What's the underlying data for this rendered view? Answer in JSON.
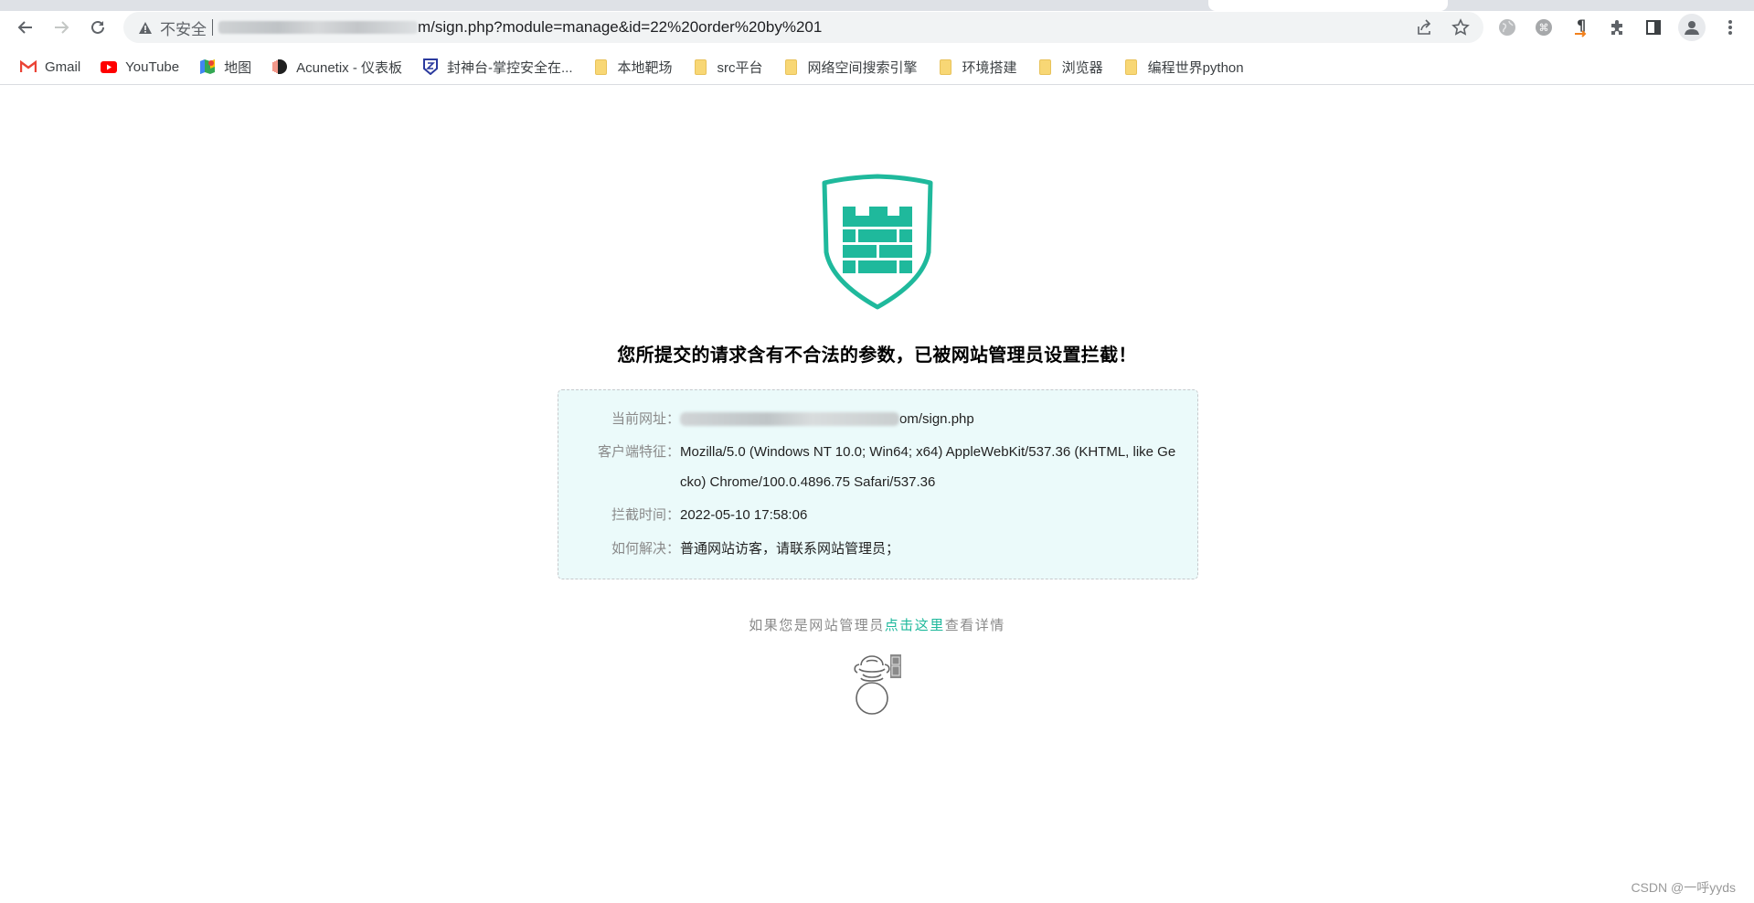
{
  "browser": {
    "nav": {
      "back_icon": "arrow-left-icon",
      "forward_icon": "arrow-right-icon",
      "reload_icon": "reload-icon"
    },
    "omnibox": {
      "security_label": "不安全",
      "url_visible": "m/sign.php?module=manage&id=22%20order%20by%201",
      "icons": [
        "share-icon",
        "bookmark-star-icon"
      ]
    },
    "extensions": [
      "globe-extension-icon",
      "command-extension-icon",
      "paragraph-extension-icon",
      "puzzle-extensions-icon",
      "side-panel-icon",
      "profile-avatar-icon",
      "more-menu-icon"
    ],
    "bookmarks": [
      {
        "label": "Gmail",
        "icon": "gmail-icon"
      },
      {
        "label": "YouTube",
        "icon": "youtube-icon"
      },
      {
        "label": "地图",
        "icon": "maps-icon"
      },
      {
        "label": "Acunetix - 仪表板",
        "icon": "acunetix-icon"
      },
      {
        "label": "封神台-掌控安全在...",
        "icon": "fengshentai-icon"
      },
      {
        "label": "本地靶场",
        "icon": "folder-icon"
      },
      {
        "label": "src平台",
        "icon": "folder-icon"
      },
      {
        "label": "网络空间搜索引擎",
        "icon": "folder-icon"
      },
      {
        "label": "环境搭建",
        "icon": "folder-icon"
      },
      {
        "label": "浏览器",
        "icon": "folder-icon"
      },
      {
        "label": "编程世界python",
        "icon": "folder-icon"
      }
    ]
  },
  "page": {
    "brand_color": "#1fb99c",
    "headline": "您所提交的请求含有不合法的参数，已被网站管理员设置拦截！",
    "info": {
      "current_url_label": "当前网址：",
      "current_url_value_suffix": "om/sign.php",
      "client_label": "客户端特征：",
      "client_value": "Mozilla/5.0 (Windows NT 10.0; Win64; x64) AppleWebKit/537.36 (KHTML, like Gecko) Chrome/100.0.4896.75 Safari/537.36",
      "time_label": "拦截时间：",
      "time_value": "2022-05-10 17:58:06",
      "solution_label": "如何解决：",
      "solution_value": "普通网站访客，请联系网站管理员；"
    },
    "admin_prefix": "如果您是网站管理员",
    "admin_link": "点击这里",
    "admin_suffix": "查看详情",
    "watermark": "CSDN @一呼yyds"
  }
}
